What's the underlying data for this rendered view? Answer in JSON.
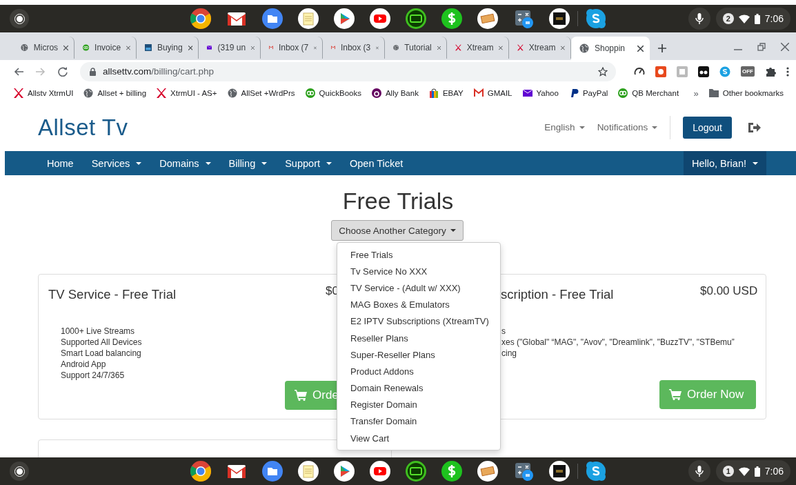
{
  "shelves": [
    {
      "notification_count": "2",
      "time": "7:06"
    },
    {
      "notification_count": "1",
      "time": "7:06"
    }
  ],
  "tabs": [
    {
      "title": "Micros",
      "kind": "globe",
      "selected": false
    },
    {
      "title": "Invoice",
      "kind": "qb",
      "selected": false
    },
    {
      "title": "Buying",
      "kind": "sa",
      "selected": false
    },
    {
      "title": "(319 un",
      "kind": "mail",
      "selected": false
    },
    {
      "title": "Inbox (7",
      "kind": "gmail",
      "selected": false
    },
    {
      "title": "Inbox (3",
      "kind": "gmail",
      "selected": false
    },
    {
      "title": "Tutorial",
      "kind": "globe",
      "selected": false
    },
    {
      "title": "Xtream",
      "kind": "x",
      "selected": false
    },
    {
      "title": "Xtream",
      "kind": "x",
      "selected": false
    },
    {
      "title": "Shoppin",
      "kind": "globe",
      "selected": true
    }
  ],
  "address_bar": {
    "host": "allsettv.com",
    "path": "/billing/cart.php"
  },
  "extensions": {
    "off_badge": "OFF"
  },
  "bookmarks": [
    {
      "label": "Allstv XtrmUI",
      "kind": "x"
    },
    {
      "label": "Allset + billing",
      "kind": "globe"
    },
    {
      "label": "XtrmUI - AS+",
      "kind": "x"
    },
    {
      "label": "AllSet +WrdPrs",
      "kind": "globe"
    },
    {
      "label": "QuickBooks",
      "kind": "qb"
    },
    {
      "label": "Ally Bank",
      "kind": "ally"
    },
    {
      "label": "EBAY",
      "kind": "bag"
    },
    {
      "label": "GMAIL",
      "kind": "gmail"
    },
    {
      "label": "Yahoo",
      "kind": "mail"
    },
    {
      "label": "PayPal",
      "kind": "paypal"
    },
    {
      "label": "QB Merchant",
      "kind": "qb"
    }
  ],
  "bookmarks_overflow": "»",
  "other_bookmarks": "Other bookmarks",
  "site": {
    "logo": "Allset Tv",
    "language": "English",
    "notifications": "Notifications",
    "logout": "Logout"
  },
  "nav": {
    "items": [
      {
        "label": "Home",
        "dropdown": false
      },
      {
        "label": "Services",
        "dropdown": true
      },
      {
        "label": "Domains",
        "dropdown": true
      },
      {
        "label": "Billing",
        "dropdown": true
      },
      {
        "label": "Support",
        "dropdown": true
      },
      {
        "label": "Open Ticket",
        "dropdown": false
      }
    ],
    "user": "Hello, Brian!"
  },
  "heading": "Free Trials",
  "category_button": "Choose Another Category",
  "category_menu": [
    "Free Trials",
    "Tv Service No XXX",
    "TV Service - (Adult w/ XXX)",
    "MAG Boxes & Emulators",
    "E2 IPTV Subscriptions (XtreamTV)",
    "Reseller Plans",
    "Super-Reseller Plans",
    "Product Addons",
    "Domain Renewals",
    "Register Domain",
    "Transfer Domain",
    "View Cart"
  ],
  "products": [
    {
      "title": "TV Service - Free Trial",
      "price": "$0",
      "features": [
        "1000+ Live Streams",
        "Supported All Devices",
        "Smart Load balancing",
        "Android App",
        "Support 24/7/365"
      ],
      "button": "Orde"
    },
    {
      "title": "scription - Free Trial",
      "price": "$0.00 USD",
      "features": [
        "s",
        "xes (\"Global\" “MAG\", \"Avov\", \"Dreamlink\", \"BuzzTV\", \"STBemu”",
        "cing"
      ],
      "button": "Order Now"
    }
  ]
}
